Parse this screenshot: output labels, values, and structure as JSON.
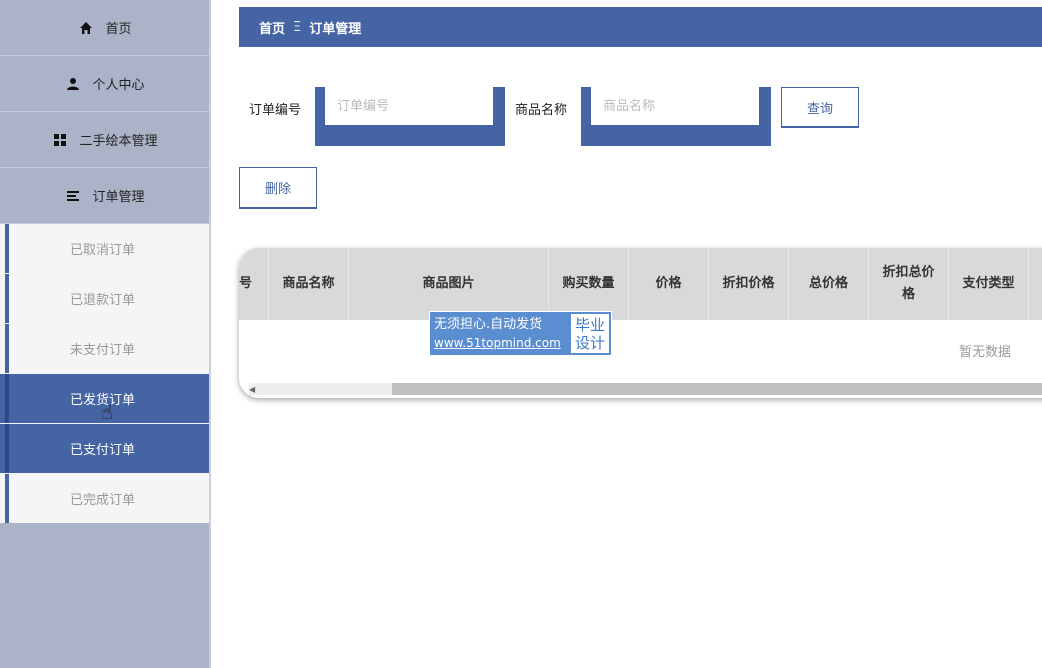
{
  "sidebar": {
    "menu": [
      {
        "label": "首页",
        "icon": "home-icon"
      },
      {
        "label": "个人中心",
        "icon": "user-icon"
      },
      {
        "label": "二手绘本管理",
        "icon": "grid-icon"
      },
      {
        "label": "订单管理",
        "icon": "list-icon"
      }
    ],
    "submenu": [
      {
        "label": "已取消订单",
        "active": false
      },
      {
        "label": "已退款订单",
        "active": false
      },
      {
        "label": "未支付订单",
        "active": false
      },
      {
        "label": "已发货订单",
        "active": true
      },
      {
        "label": "已支付订单",
        "active": true
      },
      {
        "label": "已完成订单",
        "active": false
      }
    ]
  },
  "breadcrumb": {
    "home": "首页",
    "separator": "Ξ",
    "current": "订单管理"
  },
  "search": {
    "order_no_label": "订单编号",
    "order_no_placeholder": "订单编号",
    "order_no_value": "",
    "product_name_label": "商品名称",
    "product_name_placeholder": "商品名称",
    "product_name_value": "",
    "query_button": "查询"
  },
  "actions": {
    "delete_button": "删除"
  },
  "table": {
    "columns": [
      "号",
      "商品名称",
      "商品图片",
      "购买数量",
      "价格",
      "折扣价格",
      "总价格",
      "折扣总价格",
      "支付类型"
    ],
    "empty_text": "暂无数据"
  },
  "watermark": {
    "line1": "无须担心.自动发货",
    "line2": "www.51topmind.com",
    "badge1": "毕业",
    "badge2": "设计"
  },
  "colors": {
    "primary": "#4564a4",
    "sidebar_bg": "#aab3c8",
    "header_bg": "#d9d9d9"
  }
}
